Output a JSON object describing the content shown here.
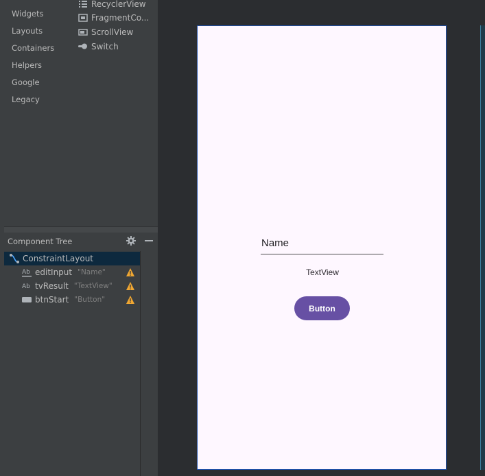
{
  "palette": {
    "categories": [
      "Widgets",
      "Layouts",
      "Containers",
      "Helpers",
      "Google",
      "Legacy"
    ],
    "items": [
      {
        "label": "RecyclerView",
        "icon": "list-icon"
      },
      {
        "label": "FragmentCo...",
        "icon": "fragment-icon"
      },
      {
        "label": "ScrollView",
        "icon": "scrollview-icon"
      },
      {
        "label": "Switch",
        "icon": "switch-icon"
      }
    ]
  },
  "component_tree": {
    "title": "Component Tree",
    "rows": [
      {
        "label": "ConstraintLayout",
        "value": "",
        "icon": "constraint-layout-icon",
        "selected": true
      },
      {
        "label": "editInput",
        "value": "\"Name\"",
        "icon": "text-field-icon",
        "warning": true
      },
      {
        "label": "tvResult",
        "value": "\"TextView\"",
        "icon": "text-view-icon",
        "warning": true
      },
      {
        "label": "btnStart",
        "value": "\"Button\"",
        "icon": "button-icon",
        "warning": true
      }
    ]
  },
  "preview": {
    "edit_hint": "Name",
    "text_view": "TextView",
    "button_label": "Button"
  },
  "colors": {
    "accent_button": "#6750a4",
    "device_background": "#fef7ff",
    "warning": "#f0a732",
    "selection": "#0d293e"
  }
}
